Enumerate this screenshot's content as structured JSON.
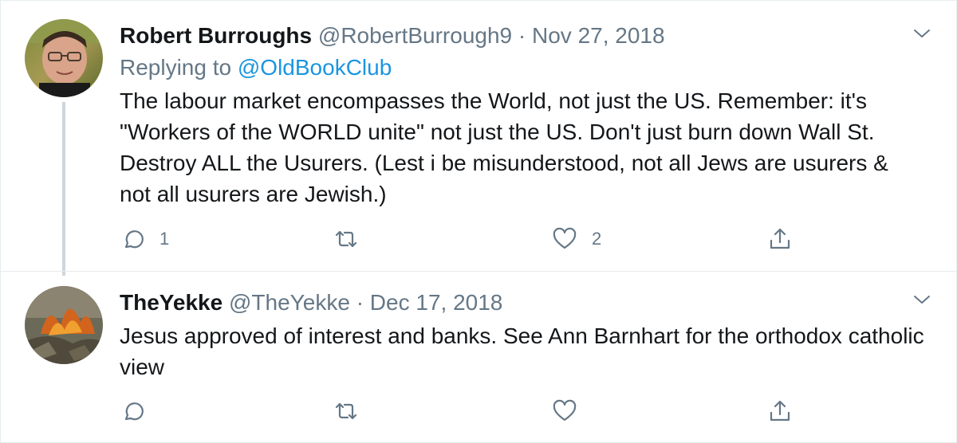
{
  "tweets": [
    {
      "name": "Robert Burroughs",
      "handle": "@RobertBurrough9",
      "separator": "·",
      "date": "Nov 27, 2018",
      "replying_prefix": "Replying to ",
      "replying_to": "@OldBookClub",
      "text": "The labour market encompasses the World, not just the US.  Remember:  it's \"Workers of the WORLD unite\" not just the US.  Don't just burn down Wall St.  Destroy ALL the Usurers. (Lest i be misunderstood, not all Jews are usurers & not all usurers are Jewish.)",
      "reply_count": "1",
      "retweet_count": "",
      "like_count": "2"
    },
    {
      "name": "TheYekke",
      "handle": "@TheYekke",
      "separator": "·",
      "date": "Dec 17, 2018",
      "text": "Jesus approved of interest and banks. See Ann Barnhart for the orthodox catholic view",
      "reply_count": "",
      "retweet_count": "",
      "like_count": ""
    }
  ],
  "icons": {
    "reply": "reply-icon",
    "retweet": "retweet-icon",
    "like": "heart-icon",
    "share": "share-icon",
    "more": "chevron-down-icon"
  },
  "colors": {
    "text": "#14171a",
    "secondary": "#657786",
    "link": "#1b95e0",
    "thread_line": "#ccd6dd",
    "border": "#e6ecf0"
  }
}
